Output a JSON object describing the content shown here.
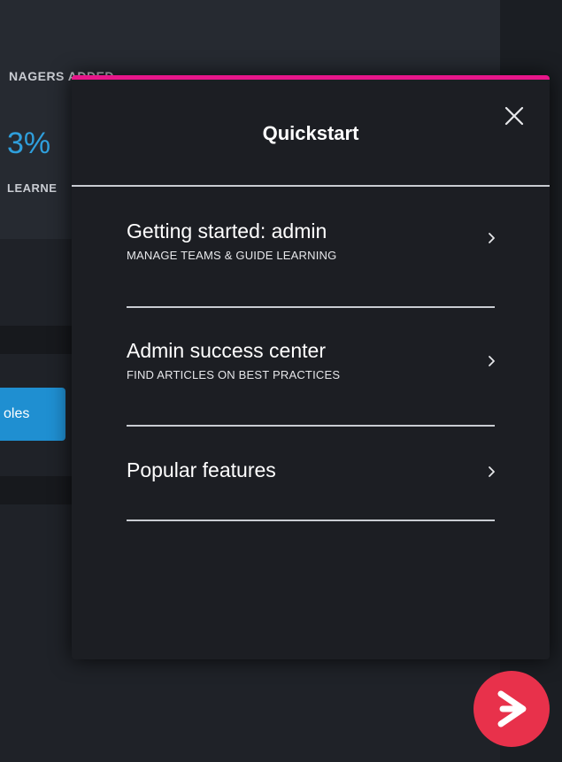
{
  "background": {
    "stat_label": "NAGERS ADDED",
    "stat_value": "3%",
    "stat_sub": "LEARNE",
    "button_label": "oles"
  },
  "quickstart": {
    "title": "Quickstart",
    "close_icon": "close-icon",
    "items": [
      {
        "title": "Getting started: admin",
        "subtitle": "MANAGE TEAMS & GUIDE LEARNING",
        "icon": "chevron-right-icon"
      },
      {
        "title": "Admin success center",
        "subtitle": "FIND ARTICLES ON BEST PRACTICES",
        "icon": "chevron-right-icon"
      },
      {
        "title": "Popular features",
        "subtitle": "",
        "icon": "chevron-right-icon"
      }
    ]
  },
  "launcher": {
    "icon": "play-arrow-icon"
  },
  "colors": {
    "accent_pink": "#e8168a",
    "launcher_red": "#e8314b",
    "link_blue": "#2f9fdc",
    "panel_bg": "#1c1e23"
  }
}
